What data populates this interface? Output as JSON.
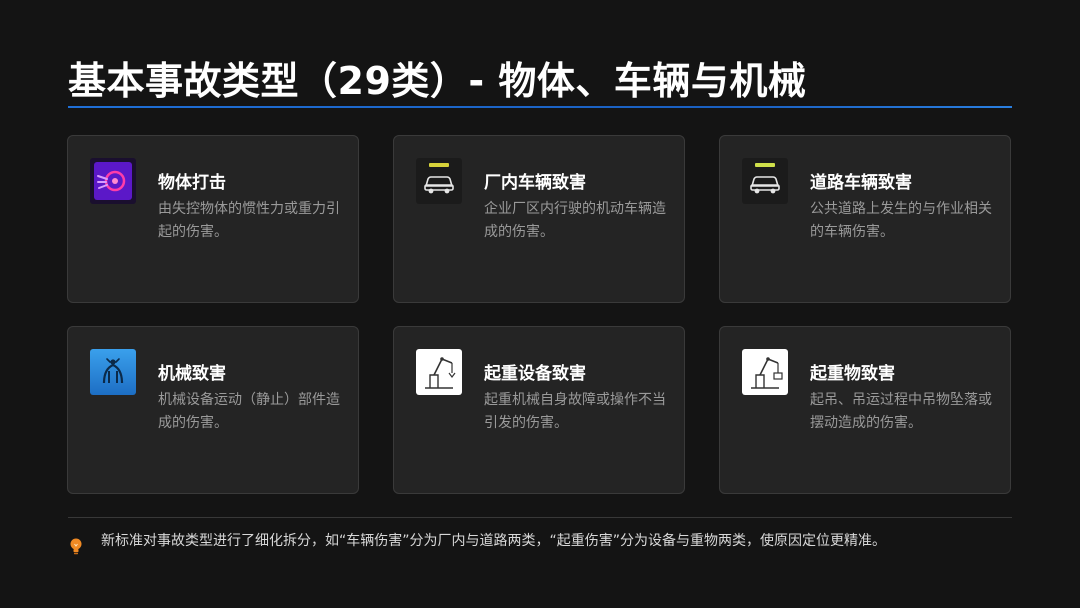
{
  "header": {
    "title": "基本事故类型（29类）- 物体、车辆与机械"
  },
  "cards": [
    {
      "title": "物体打击",
      "desc": "由失控物体的惯性力或重力引起的伤害。",
      "icon": "object-strike-icon"
    },
    {
      "title": "厂内车辆致害",
      "desc": "企业厂区内行驶的机动车辆造成的伤害。",
      "icon": "factory-vehicle-icon"
    },
    {
      "title": "道路车辆致害",
      "desc": "公共道路上发生的与作业相关的车辆伤害。",
      "icon": "road-vehicle-icon"
    },
    {
      "title": "机械致害",
      "desc": "机械设备运动（静止）部件造成的伤害。",
      "icon": "machinery-icon"
    },
    {
      "title": "起重设备致害",
      "desc": "起重机械自身故障或操作不当引发的伤害。",
      "icon": "crane-equipment-icon"
    },
    {
      "title": "起重物致害",
      "desc": "起吊、吊运过程中吊物坠落或摆动造成的伤害。",
      "icon": "lifted-load-icon"
    }
  ],
  "footer": {
    "note": "新标准对事故类型进行了细化拆分，如“车辆伤害”分为厂内与道路两类，“起重伤害”分为设备与重物两类，使原因定位更精准。",
    "icon": "lightbulb-icon"
  },
  "colors": {
    "background": "#141414",
    "card": "#242424",
    "accent": "#1f6fd6",
    "note_icon": "#f08a24"
  }
}
